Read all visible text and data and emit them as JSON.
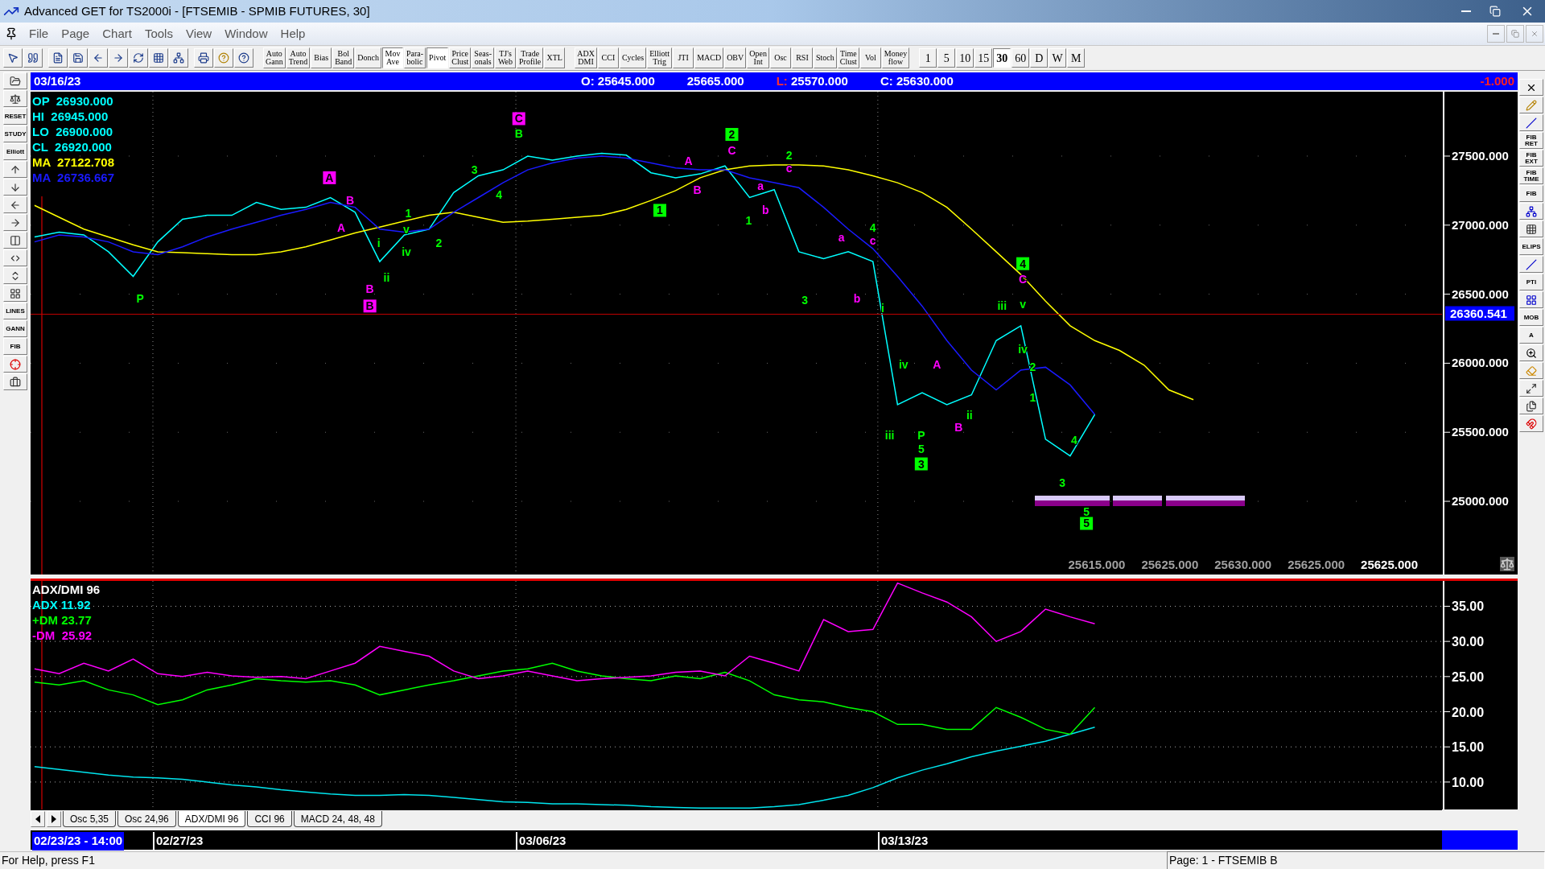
{
  "window": {
    "title": "Advanced GET for TS2000i - [FTSEMIB - SPMIB FUTURES, 30]"
  },
  "menu": [
    "File",
    "Page",
    "Chart",
    "Tools",
    "View",
    "Window",
    "Help"
  ],
  "toolbar": {
    "studies": [
      {
        "label": "Auto\nGann",
        "on": false
      },
      {
        "label": "Auto\nTrend",
        "on": false
      },
      {
        "label": "Bias",
        "on": false
      },
      {
        "label": "Bol\nBand",
        "on": false
      },
      {
        "label": "Donch",
        "on": false
      },
      {
        "label": "Mov\nAve",
        "on": true
      },
      {
        "label": "Para-\nbolic",
        "on": false
      },
      {
        "label": "Pivot",
        "on": true
      },
      {
        "label": "Price\nClust",
        "on": false
      },
      {
        "label": "Seas-\nonals",
        "on": false
      },
      {
        "label": "TJ's\nWeb",
        "on": false
      },
      {
        "label": "Trade\nProfile",
        "on": false
      },
      {
        "label": "XTL",
        "on": false
      }
    ],
    "indicators": [
      {
        "label": "ADX\nDMI",
        "on": false
      },
      {
        "label": "CCI",
        "on": false
      },
      {
        "label": "Cycles",
        "on": false
      },
      {
        "label": "Elliott\nTrig",
        "on": false
      },
      {
        "label": "JTI",
        "on": false
      },
      {
        "label": "MACD",
        "on": false
      },
      {
        "label": "OBV",
        "on": false
      },
      {
        "label": "Open\nInt",
        "on": false
      },
      {
        "label": "Osc",
        "on": false
      },
      {
        "label": "RSI",
        "on": false
      },
      {
        "label": "Stoch",
        "on": false
      },
      {
        "label": "Time\nClust",
        "on": false
      },
      {
        "label": "Vol",
        "on": false
      },
      {
        "label": "Money\nflow",
        "on": false
      }
    ],
    "timeframes": [
      {
        "label": "1",
        "selected": false
      },
      {
        "label": "5",
        "selected": false
      },
      {
        "label": "10",
        "selected": false
      },
      {
        "label": "15",
        "selected": false
      },
      {
        "label": "30",
        "selected": true
      },
      {
        "label": "60",
        "selected": false
      },
      {
        "label": "D",
        "selected": false
      },
      {
        "label": "W",
        "selected": false
      },
      {
        "label": "M",
        "selected": false
      }
    ]
  },
  "left_tools": [
    {
      "kind": "icon"
    },
    {
      "kind": "icon"
    },
    {
      "kind": "caption",
      "label": "RESET"
    },
    {
      "kind": "caption",
      "label": "STUDY"
    },
    {
      "kind": "caption",
      "label": "Elliott"
    },
    {
      "kind": "icon"
    },
    {
      "kind": "icon"
    },
    {
      "kind": "icon"
    },
    {
      "kind": "icon"
    },
    {
      "kind": "icon"
    },
    {
      "kind": "icon"
    },
    {
      "kind": "icon"
    },
    {
      "kind": "icon"
    },
    {
      "kind": "caption",
      "label": "LINES"
    },
    {
      "kind": "caption",
      "label": "GANN"
    },
    {
      "kind": "caption",
      "label": "FIB"
    },
    {
      "kind": "icon"
    },
    {
      "kind": "icon"
    }
  ],
  "right_tools": [
    {
      "kind": "icon"
    },
    {
      "kind": "icon"
    },
    {
      "kind": "icon"
    },
    {
      "kind": "caption",
      "label": "FIB\nRET"
    },
    {
      "kind": "caption",
      "label": "FIB\nEXT"
    },
    {
      "kind": "caption",
      "label": "FIB\nTIME"
    },
    {
      "kind": "caption",
      "label": "FIB"
    },
    {
      "kind": "icon"
    },
    {
      "kind": "icon"
    },
    {
      "kind": "caption",
      "label": "ELIPS"
    },
    {
      "kind": "icon"
    },
    {
      "kind": "caption",
      "label": "PTI"
    },
    {
      "kind": "icon"
    },
    {
      "kind": "caption",
      "label": "MOB"
    },
    {
      "kind": "caption",
      "label": "A"
    },
    {
      "kind": "icon"
    },
    {
      "kind": "icon"
    },
    {
      "kind": "icon"
    },
    {
      "kind": "icon"
    },
    {
      "kind": "icon"
    }
  ],
  "info_bar": {
    "date": "03/16/23",
    "items": [
      {
        "label": "O:",
        "value": "25645.000",
        "kind": "plain"
      },
      {
        "value": "25665.000"
      },
      {
        "label": "L:",
        "value": "25570.000",
        "kind": "alert"
      },
      {
        "label": "C:",
        "value": "25630.000",
        "kind": "plain"
      }
    ],
    "change": "-1.000"
  },
  "price_chart": {
    "legend": [
      {
        "label": "OP",
        "value": "26930.000",
        "color": "#00ffff"
      },
      {
        "label": "HI",
        "value": "26945.000",
        "color": "#00ffff"
      },
      {
        "label": "LO",
        "value": "26900.000",
        "color": "#00ffff"
      },
      {
        "label": "CL",
        "value": "26920.000",
        "color": "#00ffff"
      },
      {
        "label": "MA",
        "value": "27122.708",
        "color": "#ffff00"
      },
      {
        "label": "MA",
        "value": "26736.667",
        "color": "#1a1aff"
      }
    ],
    "price_strip": [
      {
        "text": "25615.000",
        "current": false
      },
      {
        "text": "25625.000",
        "current": false
      },
      {
        "text": "25630.000",
        "current": false
      },
      {
        "text": "25625.000",
        "current": false
      },
      {
        "text": "25625.000",
        "current": true
      }
    ],
    "wave_labels": [
      {
        "text": "P",
        "color": "#00ff00",
        "kind": "plain"
      },
      {
        "text": "A",
        "color": "#ff00ff",
        "kind": "boxed"
      },
      {
        "text": "A",
        "color": "#ff00ff",
        "kind": "plain"
      },
      {
        "text": "B",
        "color": "#ff00ff",
        "kind": "plain"
      },
      {
        "text": "B",
        "color": "#ff00ff",
        "kind": "plain"
      },
      {
        "text": "B",
        "color": "#ff00ff",
        "kind": "boxed"
      },
      {
        "text": "i",
        "color": "#00ff00",
        "kind": "plain"
      },
      {
        "text": "ii",
        "color": "#00ff00",
        "kind": "plain"
      },
      {
        "text": "1",
        "color": "#00ff00",
        "kind": "plain"
      },
      {
        "text": "v",
        "color": "#00ff00",
        "kind": "plain"
      },
      {
        "text": "iv",
        "color": "#00ff00",
        "kind": "plain"
      },
      {
        "text": "2",
        "color": "#00ff00",
        "kind": "plain"
      },
      {
        "text": "3",
        "color": "#00ff00",
        "kind": "plain"
      },
      {
        "text": "4",
        "color": "#00ff00",
        "kind": "plain"
      },
      {
        "text": "C",
        "color": "#ff00ff",
        "kind": "boxed"
      },
      {
        "text": "B",
        "color": "#00ff00",
        "kind": "plain"
      },
      {
        "text": "1",
        "color": "#00ff00",
        "kind": "boxed"
      },
      {
        "text": "A",
        "color": "#ff00ff",
        "kind": "plain"
      },
      {
        "text": "B",
        "color": "#ff00ff",
        "kind": "plain"
      },
      {
        "text": "2",
        "color": "#00ff00",
        "kind": "boxed"
      },
      {
        "text": "C",
        "color": "#ff00ff",
        "kind": "plain"
      },
      {
        "text": "1",
        "color": "#00ff00",
        "kind": "plain"
      },
      {
        "text": "a",
        "color": "#ff00ff",
        "kind": "plain"
      },
      {
        "text": "b",
        "color": "#ff00ff",
        "kind": "plain"
      },
      {
        "text": "2",
        "color": "#00ff00",
        "kind": "plain"
      },
      {
        "text": "c",
        "color": "#ff00ff",
        "kind": "plain"
      },
      {
        "text": "3",
        "color": "#00ff00",
        "kind": "plain"
      },
      {
        "text": "a",
        "color": "#ff00ff",
        "kind": "plain"
      },
      {
        "text": "b",
        "color": "#ff00ff",
        "kind": "plain"
      },
      {
        "text": "4",
        "color": "#00ff00",
        "kind": "plain"
      },
      {
        "text": "c",
        "color": "#ff00ff",
        "kind": "plain"
      },
      {
        "text": "i",
        "color": "#00ff00",
        "kind": "plain"
      },
      {
        "text": "iii",
        "color": "#00ff00",
        "kind": "plain"
      },
      {
        "text": "iv",
        "color": "#00ff00",
        "kind": "plain"
      },
      {
        "text": "P",
        "color": "#00ff00",
        "kind": "plain"
      },
      {
        "text": "5",
        "color": "#00ff00",
        "kind": "plain"
      },
      {
        "text": "3",
        "color": "#00ff00",
        "kind": "boxed"
      },
      {
        "text": "A",
        "color": "#ff00ff",
        "kind": "plain"
      },
      {
        "text": "B",
        "color": "#ff00ff",
        "kind": "plain"
      },
      {
        "text": "ii",
        "color": "#00ff00",
        "kind": "plain"
      },
      {
        "text": "iii",
        "color": "#00ff00",
        "kind": "plain"
      },
      {
        "text": "4",
        "color": "#00ff00",
        "kind": "boxed"
      },
      {
        "text": "C",
        "color": "#ff00ff",
        "kind": "plain"
      },
      {
        "text": "v",
        "color": "#00ff00",
        "kind": "plain"
      },
      {
        "text": "iv",
        "color": "#00ff00",
        "kind": "plain"
      },
      {
        "text": "2",
        "color": "#00ff00",
        "kind": "plain"
      },
      {
        "text": "1",
        "color": "#00ff00",
        "kind": "plain"
      },
      {
        "text": "3",
        "color": "#00ff00",
        "kind": "plain"
      },
      {
        "text": "4",
        "color": "#00ff00",
        "kind": "plain"
      },
      {
        "text": "5",
        "color": "#00ff00",
        "kind": "plain"
      },
      {
        "text": "5",
        "color": "#00ff00",
        "kind": "boxed"
      }
    ],
    "cursor_price": "26360.541",
    "chart_data": {
      "type": "line",
      "grid": true,
      "categories": [
        null,
        null,
        null,
        null,
        null,
        null,
        null,
        null,
        null,
        null,
        null,
        null,
        null,
        null,
        null,
        null,
        null,
        null,
        null,
        null,
        null,
        null,
        null,
        null,
        null,
        null,
        null,
        null,
        null,
        null,
        null,
        null,
        null,
        null,
        null,
        null,
        null,
        null,
        null,
        null,
        null,
        null,
        null,
        null,
        null,
        null,
        null,
        null
      ],
      "series": [
        {
          "color": "#00ffff",
          "values": [
            26914,
            26950,
            26929,
            26807,
            26629,
            26879,
            27043,
            27071,
            27071,
            27164,
            27114,
            27129,
            27200,
            27093,
            26736,
            26929,
            26971,
            27236,
            27357,
            27400,
            27500,
            27471,
            27500,
            27521,
            27507,
            27379,
            27343,
            27371,
            27429,
            27200,
            27257,
            26807,
            26757,
            26807,
            26736,
            25700,
            25786,
            25700,
            25771,
            26164,
            26271,
            25450,
            25329,
            25629,
            null,
            null,
            null,
            null
          ]
        },
        {
          "color": "#ffff00",
          "values": [
            27143,
            27057,
            26971,
            26914,
            26857,
            26807,
            26800,
            26793,
            26786,
            26786,
            26807,
            26843,
            26893,
            26943,
            26986,
            27029,
            27071,
            27093,
            27057,
            27021,
            27029,
            27043,
            27057,
            27071,
            27114,
            27179,
            27250,
            27343,
            27400,
            27429,
            27436,
            27436,
            27429,
            27400,
            27357,
            27307,
            27236,
            27129,
            26971,
            26807,
            26643,
            26450,
            26271,
            26164,
            26093,
            25986,
            25807,
            25736
          ]
        },
        {
          "color": "#1a1aff",
          "values": [
            26879,
            26929,
            26914,
            26879,
            26807,
            26786,
            26843,
            26914,
            26971,
            27021,
            27071,
            27114,
            27164,
            27129,
            26971,
            26950,
            26971,
            27093,
            27200,
            27307,
            27400,
            27450,
            27486,
            27500,
            27486,
            27450,
            27414,
            27400,
            27400,
            27343,
            27307,
            27271,
            27129,
            26971,
            26829,
            26629,
            26414,
            26164,
            25950,
            25807,
            25950,
            25971,
            25843,
            25629,
            null,
            null,
            null,
            null
          ]
        }
      ],
      "ylim": [
        24470,
        27966
      ],
      "yticks": [
        {
          "value": 25000,
          "label": "25000.000"
        },
        {
          "value": 25500,
          "label": "25500.000"
        },
        {
          "value": 26000,
          "label": "26000.000"
        },
        {
          "value": 26500,
          "label": "26500.000"
        },
        {
          "value": 27000,
          "label": "27000.000"
        },
        {
          "value": 27500,
          "label": "27500.000"
        }
      ]
    }
  },
  "indicator": {
    "legend": [
      {
        "text": "ADX/DMI 96",
        "color": "#ffffff"
      },
      {
        "text": "ADX 11.92",
        "color": "#00ffff"
      },
      {
        "text": "+DM 23.77",
        "color": "#00ff00"
      },
      {
        "text": "-DM  25.92",
        "color": "#ff00ff"
      }
    ],
    "chart_data": {
      "type": "line",
      "grid": true,
      "categories": [
        null,
        null,
        null,
        null,
        null,
        null,
        null,
        null,
        null,
        null,
        null,
        null,
        null,
        null,
        null,
        null,
        null,
        null,
        null,
        null,
        null,
        null,
        null,
        null,
        null,
        null,
        null,
        null,
        null,
        null,
        null,
        null,
        null,
        null,
        null,
        null,
        null,
        null,
        null,
        null,
        null,
        null,
        null,
        null,
        null,
        null,
        null,
        null
      ],
      "series": [
        {
          "color": "#00e5ee",
          "values": [
            12.2,
            11.8,
            11.4,
            11.0,
            10.7,
            10.6,
            10.4,
            10.0,
            9.6,
            9.3,
            8.9,
            8.6,
            8.3,
            8.1,
            8.1,
            8.2,
            8.1,
            7.8,
            7.5,
            7.2,
            7.1,
            6.9,
            6.9,
            6.8,
            6.7,
            6.5,
            6.4,
            6.3,
            6.3,
            6.3,
            6.5,
            6.8,
            7.4,
            8.1,
            9.2,
            10.6,
            11.7,
            12.6,
            13.6,
            14.4,
            15.1,
            15.8,
            16.8,
            17.8,
            null,
            null,
            null,
            null
          ]
        },
        {
          "color": "#00ff00",
          "values": [
            24.2,
            23.8,
            24.4,
            23.1,
            22.4,
            21.0,
            21.7,
            23.1,
            23.8,
            24.7,
            24.4,
            24.2,
            24.4,
            23.8,
            22.4,
            23.1,
            23.8,
            24.4,
            25.1,
            25.8,
            26.1,
            26.9,
            25.8,
            25.1,
            24.7,
            24.4,
            25.1,
            24.7,
            25.6,
            24.4,
            22.4,
            21.7,
            21.4,
            20.6,
            20.0,
            18.2,
            18.2,
            17.5,
            17.5,
            20.6,
            19.2,
            17.5,
            16.8,
            20.6,
            null,
            null,
            null,
            null
          ]
        },
        {
          "color": "#ff00ff",
          "values": [
            26.1,
            25.4,
            26.9,
            25.8,
            27.5,
            25.4,
            25.0,
            25.6,
            25.1,
            24.9,
            25.0,
            24.7,
            25.8,
            26.9,
            29.3,
            28.6,
            27.9,
            25.8,
            24.7,
            25.1,
            25.8,
            25.1,
            24.4,
            24.7,
            24.9,
            25.1,
            25.6,
            25.8,
            25.1,
            27.9,
            26.9,
            25.8,
            33.1,
            31.4,
            31.7,
            38.3,
            36.9,
            35.6,
            33.5,
            30.0,
            31.4,
            34.6,
            33.5,
            32.5,
            null,
            null,
            null,
            null
          ]
        }
      ],
      "ylim": [
        6.1,
        38.6
      ],
      "yticks": [
        {
          "value": 10,
          "label": "10.00"
        },
        {
          "value": 15,
          "label": "15.00"
        },
        {
          "value": 20,
          "label": "20.00"
        },
        {
          "value": 25,
          "label": "25.00"
        },
        {
          "value": 30,
          "label": "30.00"
        },
        {
          "value": 35,
          "label": "35.00"
        }
      ]
    }
  },
  "indicator_tabs": [
    {
      "label": "Osc 5,35",
      "selected": false
    },
    {
      "label": "Osc 24,96",
      "selected": false
    },
    {
      "label": "ADX/DMI 96",
      "selected": true
    },
    {
      "label": "CCI 96",
      "selected": false
    },
    {
      "label": "MACD 24, 48, 48",
      "selected": false
    }
  ],
  "date_bar": {
    "start": "02/23/23 - 14:00",
    "ticks": [
      "02/27/23",
      "03/06/23",
      "03/13/23"
    ]
  },
  "status_bar": {
    "help": "For Help, press F1",
    "page": "Page: 1 - FTSEMIB B"
  }
}
